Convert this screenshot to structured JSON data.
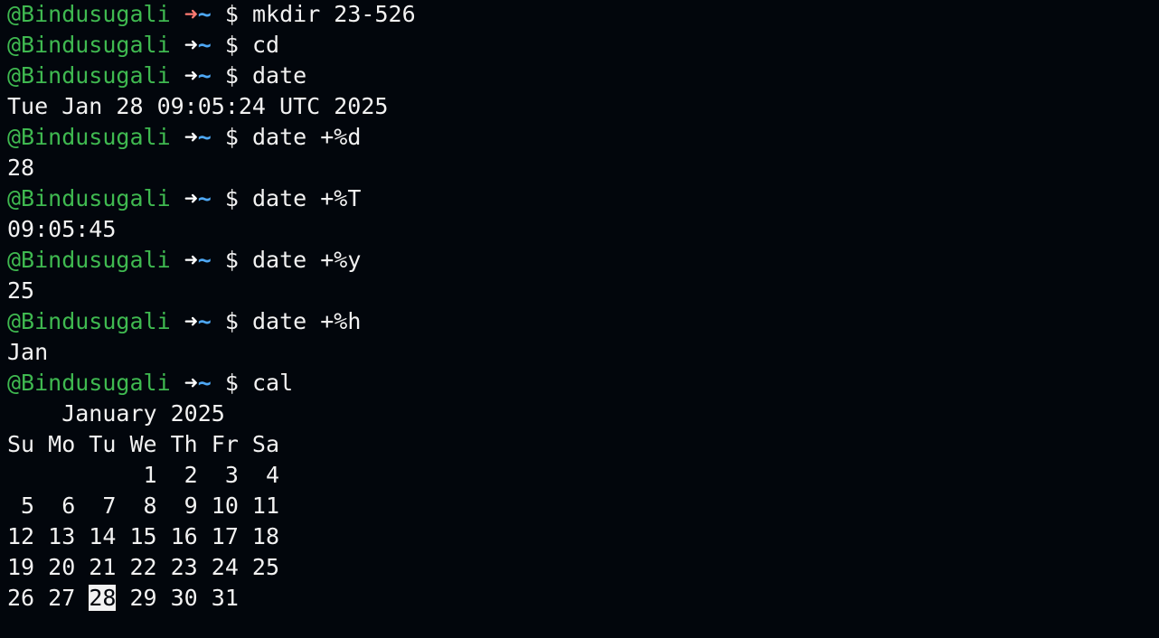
{
  "prompt": {
    "user": "@Bindusugali",
    "arrow": "➜",
    "path": "~",
    "symbol": "$"
  },
  "colors": {
    "background": "#02060c",
    "user": "#3fb950",
    "arrow_success": "#ffffff",
    "arrow_error": "#ff7b72",
    "path": "#4ea8f5",
    "text": "#f2f2f2"
  },
  "history": [
    {
      "command": "mkdir 23-526",
      "status": "error",
      "output": []
    },
    {
      "command": "cd",
      "status": "ok",
      "output": []
    },
    {
      "command": "date",
      "status": "ok",
      "output": [
        "Tue Jan 28 09:05:24 UTC 2025"
      ]
    },
    {
      "command": "date +%d",
      "status": "ok",
      "output": [
        "28"
      ]
    },
    {
      "command": "date +%T",
      "status": "ok",
      "output": [
        "09:05:45"
      ]
    },
    {
      "command": "date +%y",
      "status": "ok",
      "output": [
        "25"
      ]
    },
    {
      "command": "date +%h",
      "status": "ok",
      "output": [
        "Jan"
      ]
    },
    {
      "command": "cal",
      "status": "ok",
      "output": []
    }
  ],
  "calendar": {
    "title": "    January 2025",
    "weekdays": "Su Mo Tu We Th Fr Sa",
    "rows": [
      "          1  2  3  4",
      " 5  6  7  8  9 10 11",
      "12 13 14 15 16 17 18",
      "19 20 21 22 23 24 25"
    ],
    "last_row_before": "26 27 ",
    "today": "28",
    "last_row_after": " 29 30 31"
  }
}
